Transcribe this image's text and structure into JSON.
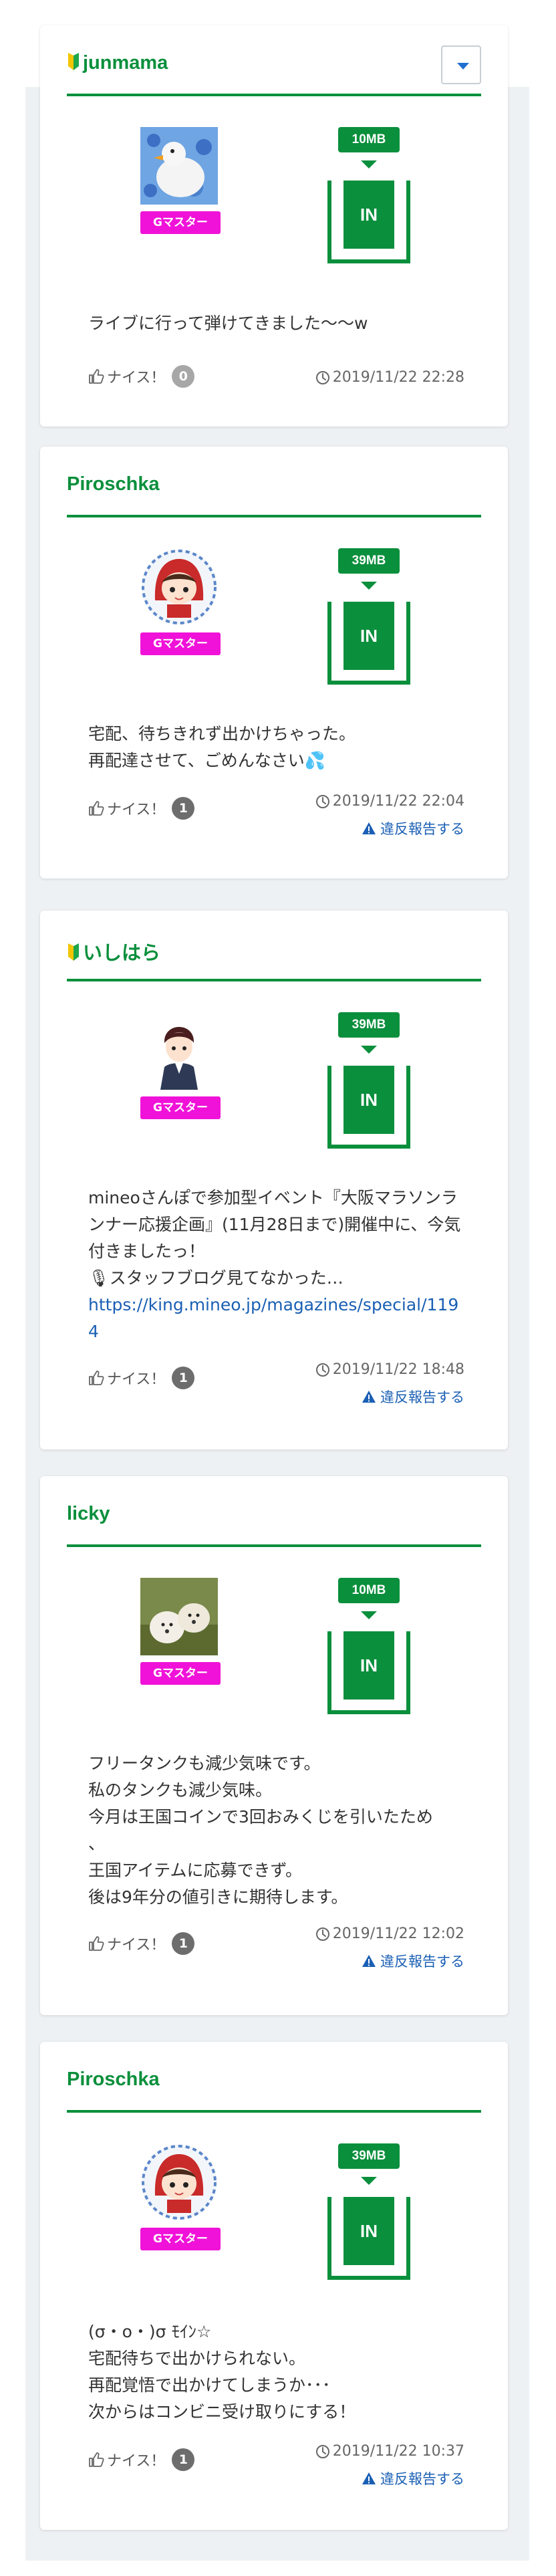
{
  "posts": [
    {
      "username": "junmama",
      "beginner": true,
      "has_menu": true,
      "badge": "Gマスター",
      "data_amount": "10MB",
      "tank_label": "IN",
      "body": "ライブに行って弾けてきました〜〜w",
      "nice_label": "ナイス！",
      "nice_count": "0",
      "date": "2019/11/22 22:28",
      "report": ""
    },
    {
      "username": "Piroschka",
      "beginner": false,
      "badge": "Gマスター",
      "data_amount": "39MB",
      "tank_label": "IN",
      "body": "宅配、待ちきれず出かけちゃった。\n再配達させて、ごめんなさい💦",
      "nice_label": "ナイス！",
      "nice_count": "1",
      "date": "2019/11/22 22:04",
      "report": "違反報告する"
    },
    {
      "username": "いしはら",
      "beginner": true,
      "badge": "Gマスター",
      "data_amount": "39MB",
      "tank_label": "IN",
      "body": "mineoさんぽで参加型イベント『大阪マラソンランナー応援企画』(11月28日まで)開催中に、今気付きましたっ！\n🎙スタッフブログ見てなかった…",
      "link": "https://king.mineo.jp/magazines/special/1194",
      "nice_label": "ナイス！",
      "nice_count": "1",
      "date": "2019/11/22 18:48",
      "report": "違反報告する"
    },
    {
      "username": "licky",
      "beginner": false,
      "badge": "Gマスター",
      "data_amount": "10MB",
      "tank_label": "IN",
      "body": "フリータンクも減少気味です。\n私のタンクも減少気味。\n今月は王国コインで3回おみくじを引いたため\n、\n王国アイテムに応募できず。\n後は9年分の値引きに期待します。",
      "nice_label": "ナイス！",
      "nice_count": "1",
      "date": "2019/11/22 12:02",
      "report": "違反報告する"
    },
    {
      "username": "Piroschka",
      "beginner": false,
      "badge": "Gマスター",
      "data_amount": "39MB",
      "tank_label": "IN",
      "body": "(σ・o・)σ ﾓｲﾝ☆\n宅配待ちで出かけられない。\n再配覚悟で出かけてしまうか･･･\n次からはコンビニ受け取りにする！",
      "nice_label": "ナイス！",
      "nice_count": "1",
      "date": "2019/11/22 10:37",
      "report": "違反報告する"
    }
  ],
  "colors": {
    "accent": "#0a8f3c",
    "badge": "#f012d8",
    "link": "#1a5fb4"
  }
}
